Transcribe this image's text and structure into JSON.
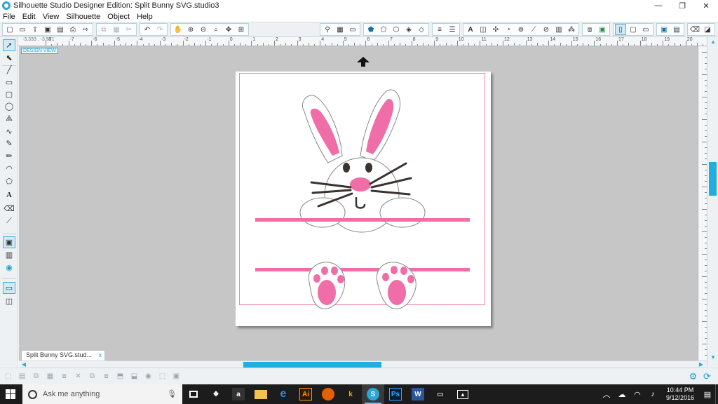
{
  "window": {
    "title": "Silhouette Studio Designer Edition: Split Bunny SVG.studio3",
    "minimize": "—",
    "restore": "❐",
    "close": "✕"
  },
  "menu": [
    "File",
    "Edit",
    "View",
    "Silhouette",
    "Object",
    "Help"
  ],
  "canvas": {
    "design_view_label": "DESIGN VIEW",
    "ruler_readout": "-3.333 , -3.571",
    "ruler_numbers": [
      "-8",
      "-7",
      "-6",
      "-5",
      "-4",
      "-3",
      "-2",
      "-1",
      "0",
      "1",
      "2",
      "3",
      "4",
      "5",
      "6",
      "7",
      "8",
      "9",
      "10",
      "11",
      "12",
      "13",
      "14",
      "15",
      "16",
      "17",
      "18",
      "19",
      "20",
      "21"
    ]
  },
  "document_tab": {
    "label": "Split Bunny SVG.stud...",
    "close": "x"
  },
  "taskbar": {
    "search_placeholder": "Ask me anything",
    "time": "10:44 PM",
    "date": "9/12/2016"
  },
  "colors": {
    "accent": "#20aee0",
    "bunny_pink": "#ef6ea7",
    "whisker": "#3a3330",
    "cut_line": "#ef8a9b"
  },
  "icons": {
    "toolbar": [
      "new-file-icon",
      "open-icon",
      "import-icon",
      "save-icon",
      "save-library-icon",
      "print-icon",
      "send-icon",
      "copy-icon",
      "paste-icon",
      "cut-icon",
      "undo-icon",
      "redo-icon",
      "pan-icon",
      "zoom-in-icon",
      "zoom-out-icon",
      "zoom-select-icon",
      "drag-zoom-icon",
      "fit-page-icon"
    ],
    "toolbar_right": [
      "shape-library-icon",
      "grid-icon",
      "page-setup-icon",
      "fill-icon",
      "gradient-icon",
      "pattern-icon",
      "line-style-icon",
      "line-color-icon",
      "text-style-icon",
      "transform-icon",
      "replicate-icon",
      "modify-icon",
      "offset-icon",
      "trace-icon",
      "knife-icon",
      "image-effects-icon",
      "rhinestone-icon",
      "sketch-icon",
      "layers-icon",
      "print-cut-icon",
      "library-icon",
      "store-icon",
      "send-panel-icon"
    ]
  }
}
